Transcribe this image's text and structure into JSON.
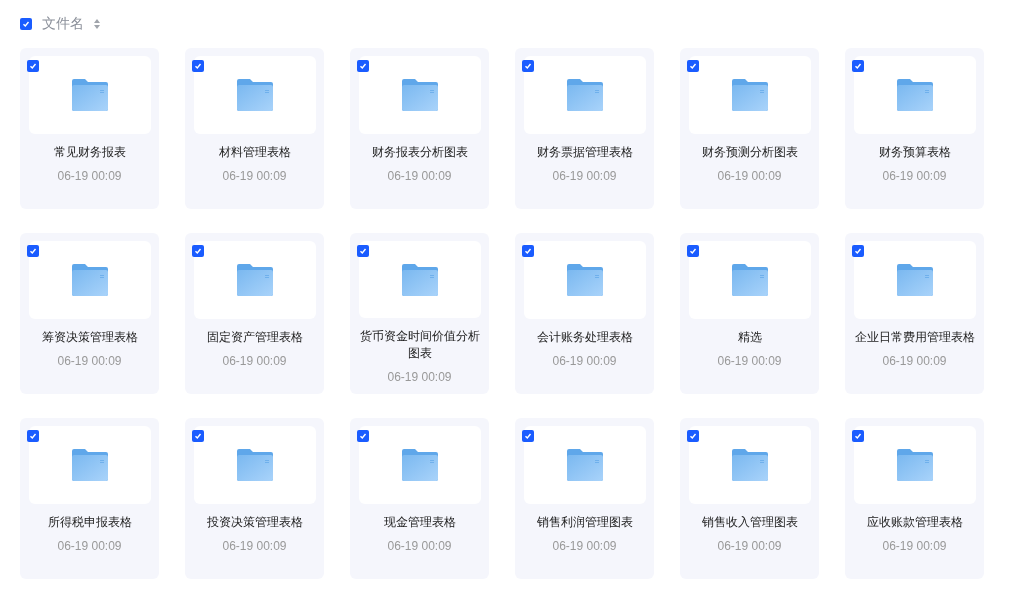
{
  "header": {
    "checked": true,
    "label": "文件名"
  },
  "files": [
    {
      "name": "常见财务报表",
      "date": "06-19 00:09",
      "checked": true
    },
    {
      "name": "材料管理表格",
      "date": "06-19 00:09",
      "checked": true
    },
    {
      "name": "财务报表分析图表",
      "date": "06-19 00:09",
      "checked": true
    },
    {
      "name": "财务票据管理表格",
      "date": "06-19 00:09",
      "checked": true
    },
    {
      "name": "财务预测分析图表",
      "date": "06-19 00:09",
      "checked": true
    },
    {
      "name": "财务预算表格",
      "date": "06-19 00:09",
      "checked": true
    },
    {
      "name": "筹资决策管理表格",
      "date": "06-19 00:09",
      "checked": true
    },
    {
      "name": "固定资产管理表格",
      "date": "06-19 00:09",
      "checked": true
    },
    {
      "name": "货币资金时间价值分析图表",
      "date": "06-19 00:09",
      "checked": true
    },
    {
      "name": "会计账务处理表格",
      "date": "06-19 00:09",
      "checked": true
    },
    {
      "name": "精选",
      "date": "06-19 00:09",
      "checked": true
    },
    {
      "name": "企业日常费用管理表格",
      "date": "06-19 00:09",
      "checked": true
    },
    {
      "name": "所得税申报表格",
      "date": "06-19 00:09",
      "checked": true
    },
    {
      "name": "投资决策管理表格",
      "date": "06-19 00:09",
      "checked": true
    },
    {
      "name": "现金管理表格",
      "date": "06-19 00:09",
      "checked": true
    },
    {
      "name": "销售利润管理图表",
      "date": "06-19 00:09",
      "checked": true
    },
    {
      "name": "销售收入管理图表",
      "date": "06-19 00:09",
      "checked": true
    },
    {
      "name": "应收账款管理表格",
      "date": "06-19 00:09",
      "checked": true
    }
  ]
}
